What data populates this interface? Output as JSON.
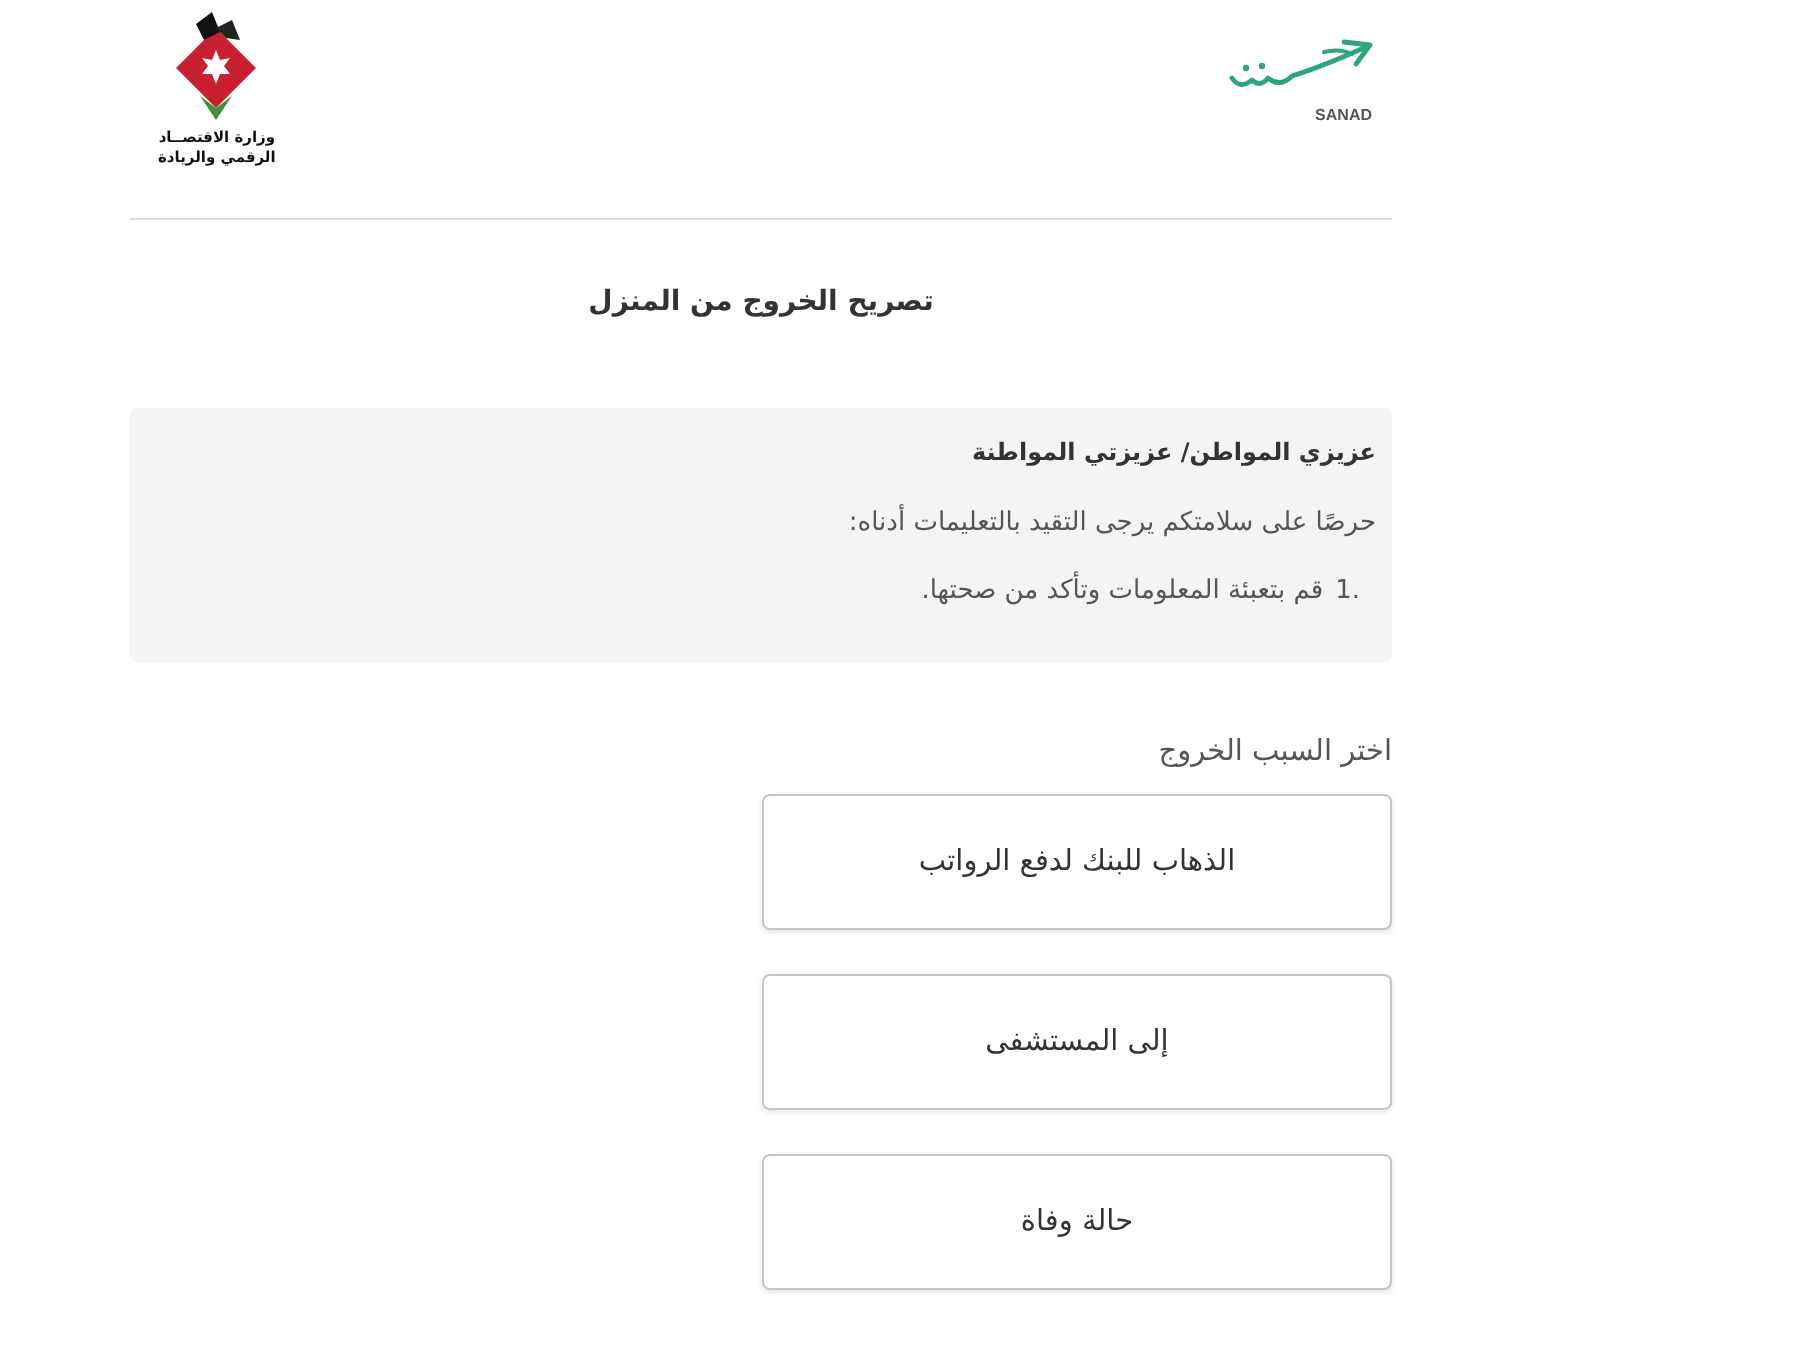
{
  "header": {
    "ministry_logo": {
      "lines": [
        "وزارة الاقتصــاد",
        "الرقمي والريادة"
      ]
    },
    "sanad_logo": {
      "label": "SANAD"
    }
  },
  "title": "تصريح الخروج من المنزل",
  "notice": {
    "heading": "عزيزي المواطن/ عزيزتي المواطنة",
    "text": "حرصًا على سلامتكم يرجى التقيد بالتعليمات أدناه:",
    "items": [
      {
        "number": "1.",
        "text": "قم بتعبئة المعلومات وتأكد من صحتها."
      }
    ]
  },
  "reasons": {
    "label": "اختر السبب الخروج",
    "options": [
      {
        "label": "الذهاب للبنك لدفع الرواتب",
        "selected": false
      },
      {
        "label": "إلى المستشفى",
        "selected": false
      },
      {
        "label": "حالة وفاة",
        "selected": false
      }
    ]
  }
}
